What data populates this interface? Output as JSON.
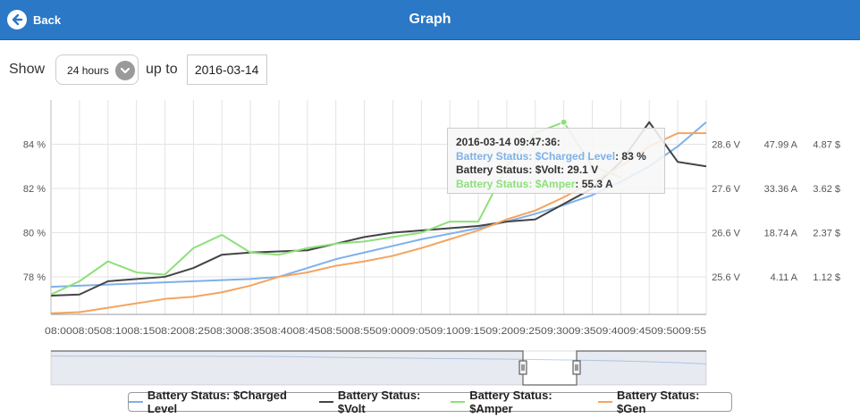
{
  "header": {
    "back_label": "Back",
    "title": "Graph"
  },
  "controls": {
    "show_label": "Show",
    "range_value": "24 hours",
    "upto_label": "up to",
    "date_value": "2016-03-14"
  },
  "colors": {
    "header_bg": "#2a78c6",
    "charged": "#7eb1ea",
    "volt": "#444444",
    "amper": "#8de07a",
    "gen": "#f4a460"
  },
  "tooltip": {
    "time": "2016-03-14 09:47:36:",
    "line1_label": "Battery Status: $Charged Level",
    "line1_value": ": 83 %",
    "line2_label": "Battery Status: $Volt",
    "line2_value": ": 29.1 V",
    "line3_label": "Battery Status: $Amper",
    "line3_value": ": 55.3 A"
  },
  "chart_data": {
    "type": "line",
    "x": [
      "08:00",
      "08:05",
      "08:10",
      "08:15",
      "08:20",
      "08:25",
      "08:30",
      "08:35",
      "08:40",
      "08:45",
      "08:50",
      "08:55",
      "09:00",
      "09:05",
      "09:10",
      "09:15",
      "09:20",
      "09:25",
      "09:30",
      "09:35",
      "09:40",
      "09:45",
      "09:50",
      "09:55"
    ],
    "x_tick_labels": [
      "08:00",
      "08:05",
      "08:10",
      "08:15",
      "08:20",
      "08:25",
      "08:30",
      "08:35",
      "08:40",
      "08:45",
      "08:50",
      "08:55",
      "09:00",
      "09:05",
      "09:10",
      "09:15",
      "09:20",
      "09:25",
      "09:30",
      "09:35",
      "09:40",
      "09:45",
      "09:50",
      "09:55"
    ],
    "left_axis": {
      "ticks": [
        "78 %",
        "80 %",
        "82 %",
        "84 %"
      ],
      "ylim": [
        76.3,
        86.0
      ]
    },
    "right_axes": [
      {
        "ticks": [
          "25.6 V",
          "26.6 V",
          "27.6 V",
          "28.6 V"
        ]
      },
      {
        "ticks": [
          "4.11 A",
          "18.74 A",
          "33.36 A",
          "47.99 A"
        ]
      },
      {
        "ticks": [
          "1.12 $",
          "2.37 $",
          "3.62 $",
          "4.87 $"
        ]
      }
    ],
    "grid": true,
    "series": [
      {
        "name": "Battery Status: $Charged Level",
        "color": "#7eb1ea",
        "y": [
          77.55,
          77.6,
          77.65,
          77.7,
          77.75,
          77.8,
          77.85,
          77.9,
          78.0,
          78.4,
          78.8,
          79.1,
          79.4,
          79.7,
          79.95,
          80.2,
          80.5,
          80.85,
          81.25,
          81.7,
          82.3,
          83.0,
          83.9,
          85.0
        ]
      },
      {
        "name": "Battery Status: $Volt",
        "color": "#444444",
        "y": [
          77.15,
          77.2,
          77.8,
          77.9,
          78.0,
          78.4,
          79.0,
          79.1,
          79.15,
          79.2,
          79.5,
          79.8,
          80.0,
          80.1,
          80.2,
          80.3,
          80.5,
          80.6,
          81.3,
          82.0,
          83.2,
          85.0,
          83.2,
          83.0
        ]
      },
      {
        "name": "Battery Status: $Amper",
        "color": "#8de07a",
        "y": [
          77.2,
          77.8,
          78.7,
          78.2,
          78.1,
          79.3,
          79.9,
          79.1,
          79.0,
          79.3,
          79.5,
          79.6,
          79.8,
          80.0,
          80.5,
          80.5,
          83.0,
          84.5,
          85.0,
          83.0,
          82.5
        ]
      },
      {
        "name": "Battery Status: $Gen",
        "color": "#f4a460",
        "y": [
          76.35,
          76.4,
          76.6,
          76.8,
          77.0,
          77.1,
          77.3,
          77.6,
          78.0,
          78.2,
          78.5,
          78.7,
          78.95,
          79.3,
          79.7,
          80.1,
          80.6,
          81.0,
          81.6,
          82.3,
          83.0,
          83.9,
          84.5,
          84.5
        ]
      }
    ],
    "highlight": {
      "series": "Battery Status: $Amper",
      "x": "09:47:36"
    }
  }
}
